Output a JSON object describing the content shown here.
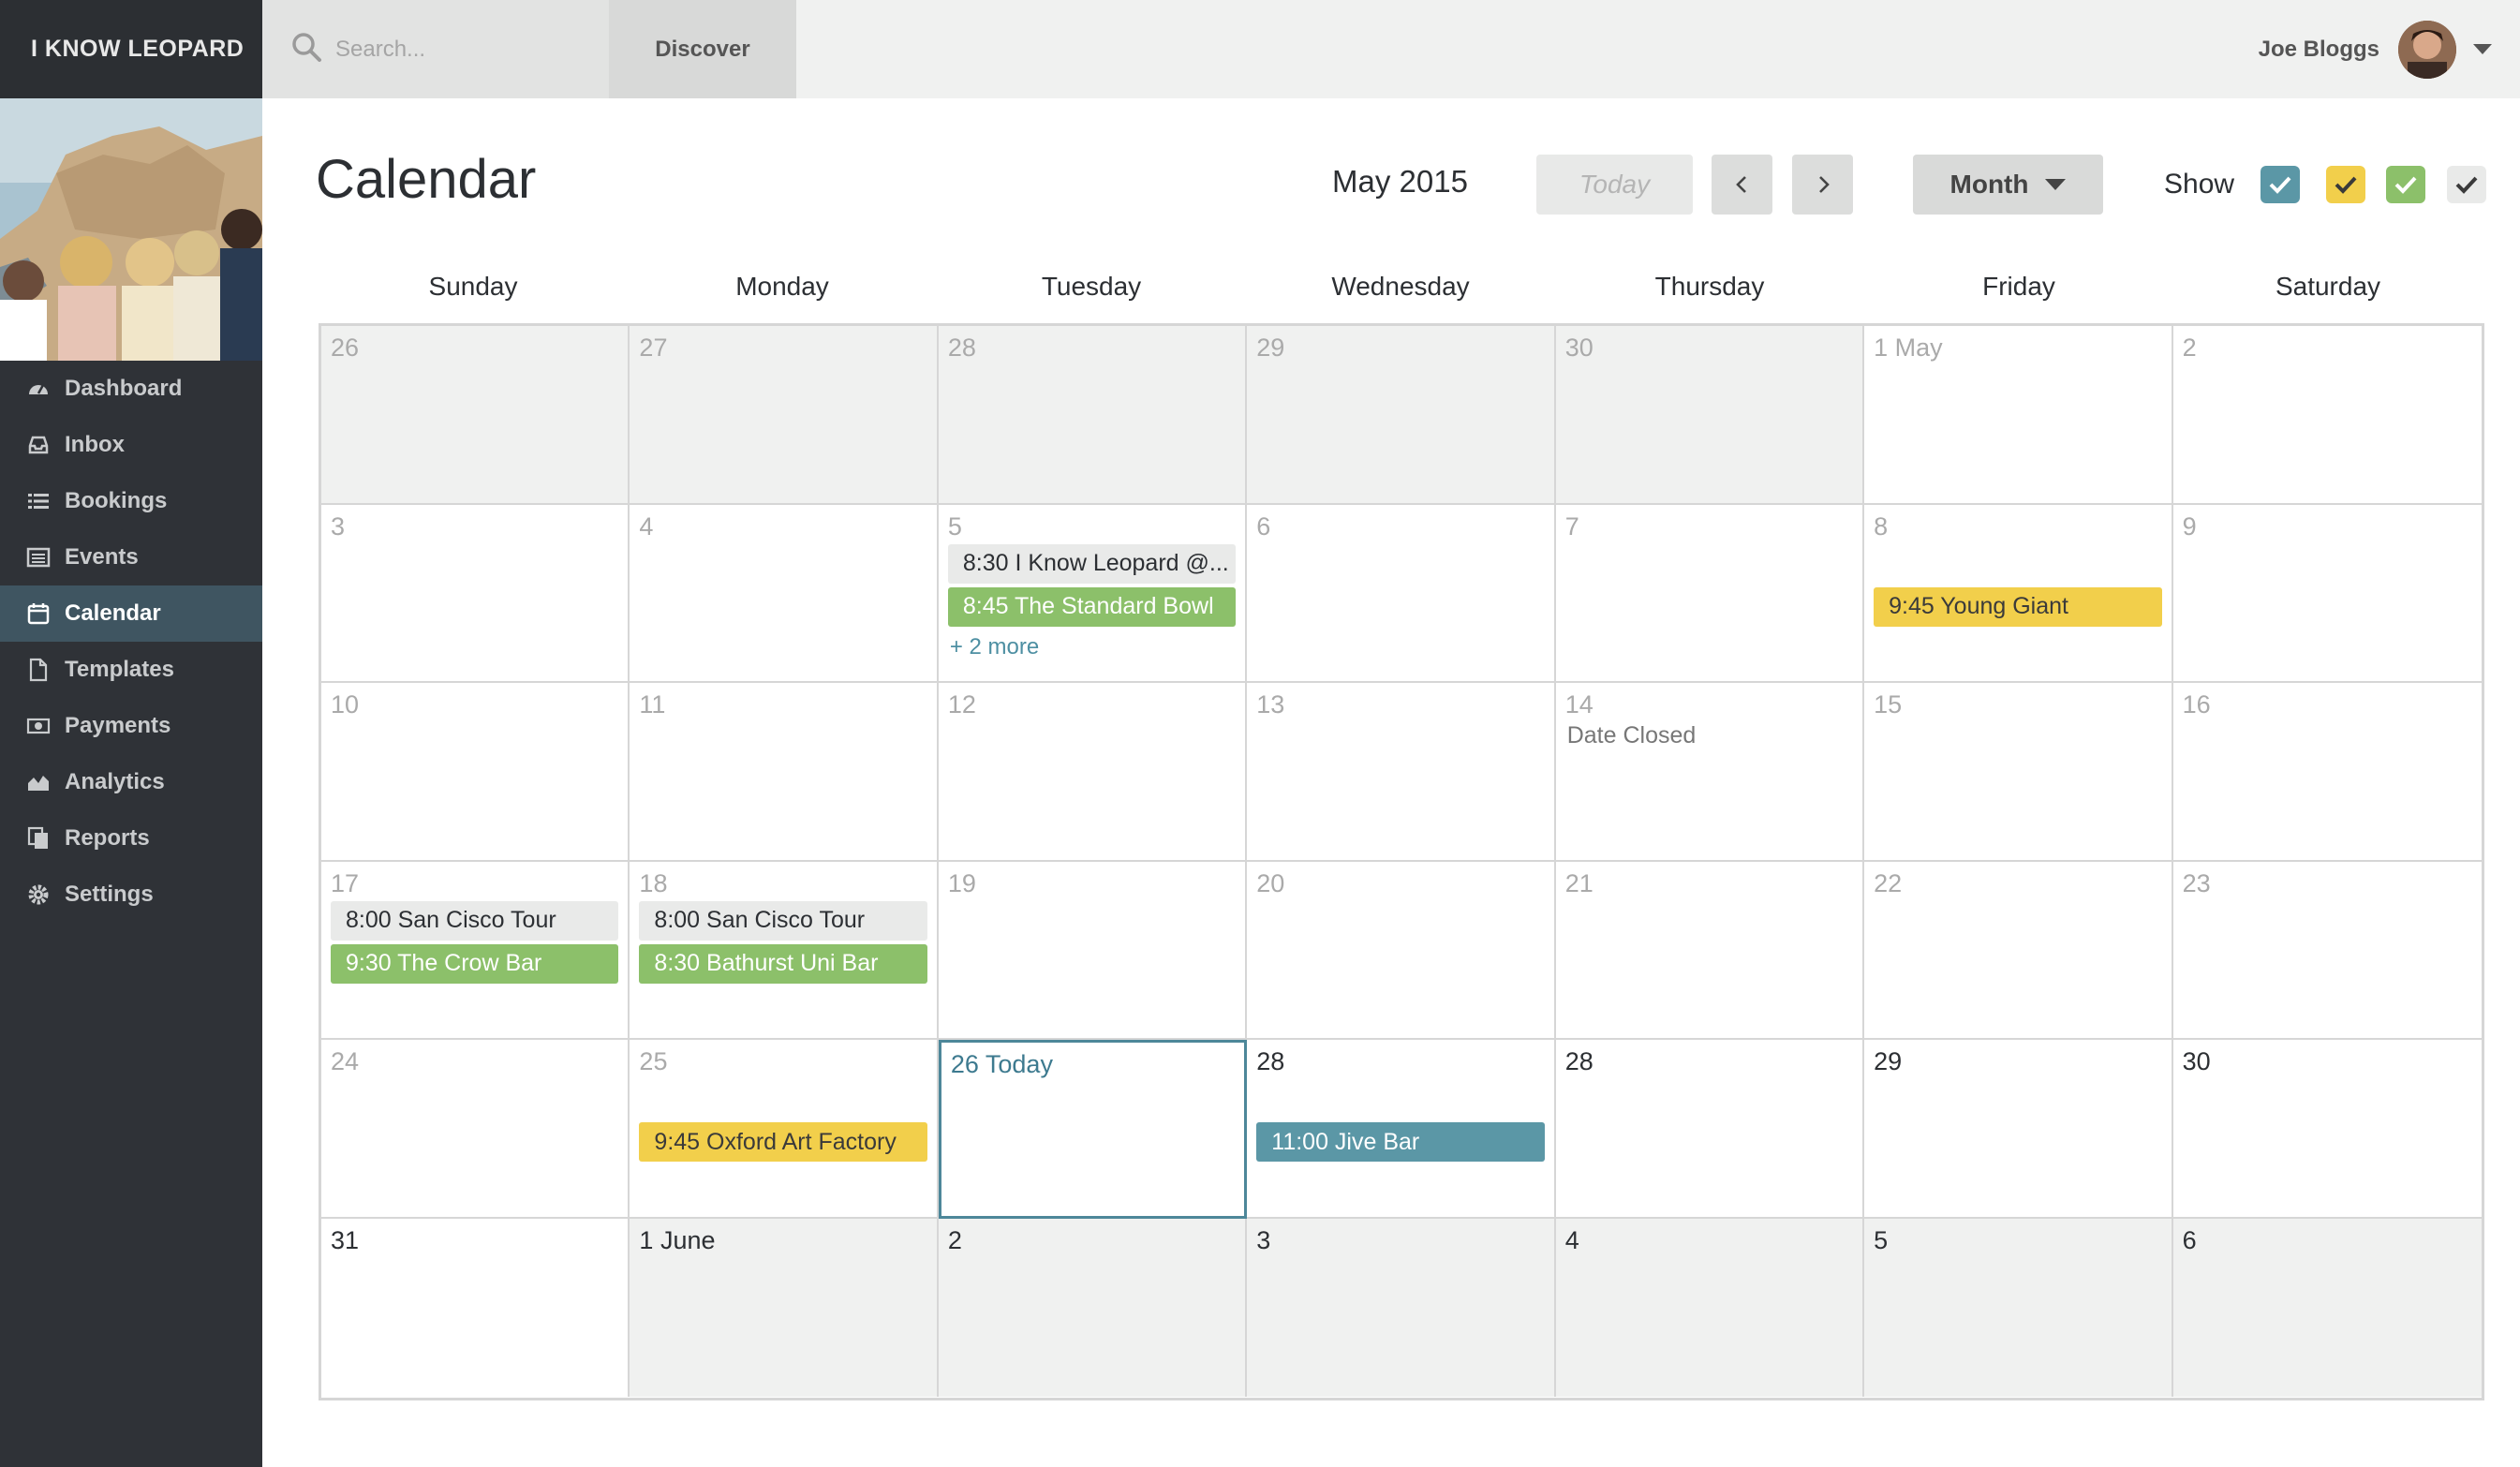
{
  "app": {
    "brand": "I KNOW LEOPARD"
  },
  "topbar": {
    "search_placeholder": "Search...",
    "discover": "Discover",
    "user_name": "Joe Bloggs"
  },
  "sidebar": {
    "items": [
      {
        "label": "Dashboard",
        "icon": "dashboard-icon"
      },
      {
        "label": "Inbox",
        "icon": "inbox-icon"
      },
      {
        "label": "Bookings",
        "icon": "list-icon"
      },
      {
        "label": "Events",
        "icon": "events-icon"
      },
      {
        "label": "Calendar",
        "icon": "calendar-icon",
        "active": true
      },
      {
        "label": "Templates",
        "icon": "document-icon"
      },
      {
        "label": "Payments",
        "icon": "money-icon"
      },
      {
        "label": "Analytics",
        "icon": "area-chart-icon"
      },
      {
        "label": "Reports",
        "icon": "reports-icon"
      },
      {
        "label": "Settings",
        "icon": "gear-icon"
      }
    ]
  },
  "header": {
    "title": "Calendar",
    "month": "May 2015",
    "today_button": "Today",
    "view_button": "Month",
    "show_label": "Show",
    "filters": [
      {
        "color": "#5b97a6",
        "checked": true
      },
      {
        "color": "#f2cf4b",
        "checked": true
      },
      {
        "color": "#8cc06a",
        "checked": true
      },
      {
        "color": "#e9eae9",
        "checked": true
      }
    ]
  },
  "calendar": {
    "weekdays": [
      "Sunday",
      "Monday",
      "Tuesday",
      "Wednesday",
      "Thursday",
      "Friday",
      "Saturday"
    ],
    "weeks": [
      [
        {
          "label": "26",
          "style": "past-other"
        },
        {
          "label": "27",
          "style": "past-other"
        },
        {
          "label": "28",
          "style": "past-other"
        },
        {
          "label": "29",
          "style": "past-other"
        },
        {
          "label": "30",
          "style": "past-other"
        },
        {
          "label": "1 May",
          "style": "past"
        },
        {
          "label": "2",
          "style": "past"
        }
      ],
      [
        {
          "label": "3",
          "style": "past"
        },
        {
          "label": "4",
          "style": "past"
        },
        {
          "label": "5",
          "style": "past",
          "events": [
            {
              "text": "8:30 I Know Leopard @...",
              "color": "grey"
            },
            {
              "text": "8:45 The Standard Bowl",
              "color": "green"
            }
          ],
          "more": "+ 2 more"
        },
        {
          "label": "6",
          "style": "past"
        },
        {
          "label": "7",
          "style": "past"
        },
        {
          "label": "8",
          "style": "past",
          "events": [
            {
              "text": "9:45 Young Giant",
              "color": "yellow",
              "slot": 1
            }
          ]
        },
        {
          "label": "9",
          "style": "past"
        }
      ],
      [
        {
          "label": "10",
          "style": "past"
        },
        {
          "label": "11",
          "style": "past"
        },
        {
          "label": "12",
          "style": "past"
        },
        {
          "label": "13",
          "style": "past"
        },
        {
          "label": "14",
          "style": "past",
          "note": "Date Closed"
        },
        {
          "label": "15",
          "style": "past"
        },
        {
          "label": "16",
          "style": "past"
        }
      ],
      [
        {
          "label": "17",
          "style": "past",
          "events": [
            {
              "text": "8:00 San Cisco Tour",
              "color": "grey"
            },
            {
              "text": "9:30 The Crow Bar",
              "color": "green"
            }
          ]
        },
        {
          "label": "18",
          "style": "past",
          "events": [
            {
              "text": "8:00 San Cisco Tour",
              "color": "grey"
            },
            {
              "text": "8:30 Bathurst Uni Bar",
              "color": "green"
            }
          ]
        },
        {
          "label": "19",
          "style": "past"
        },
        {
          "label": "20",
          "style": "past"
        },
        {
          "label": "21",
          "style": "past"
        },
        {
          "label": "22",
          "style": "past"
        },
        {
          "label": "23",
          "style": "past"
        }
      ],
      [
        {
          "label": "24",
          "style": "past"
        },
        {
          "label": "25",
          "style": "past",
          "events": [
            {
              "text": "9:45 Oxford Art Factory",
              "color": "yellow",
              "slot": 1
            }
          ]
        },
        {
          "label": "26 Today",
          "style": "today"
        },
        {
          "label": "28",
          "style": "future",
          "events": [
            {
              "text": "11:00 Jive Bar",
              "color": "teal",
              "slot": 1
            }
          ]
        },
        {
          "label": "28",
          "style": "future"
        },
        {
          "label": "29",
          "style": "future"
        },
        {
          "label": "30",
          "style": "future"
        }
      ],
      [
        {
          "label": "31",
          "style": "future"
        },
        {
          "label": "1 June",
          "style": "future-other"
        },
        {
          "label": "2",
          "style": "future-other"
        },
        {
          "label": "3",
          "style": "future-other"
        },
        {
          "label": "4",
          "style": "future-other"
        },
        {
          "label": "5",
          "style": "future-other"
        },
        {
          "label": "6",
          "style": "future-other"
        }
      ]
    ]
  }
}
